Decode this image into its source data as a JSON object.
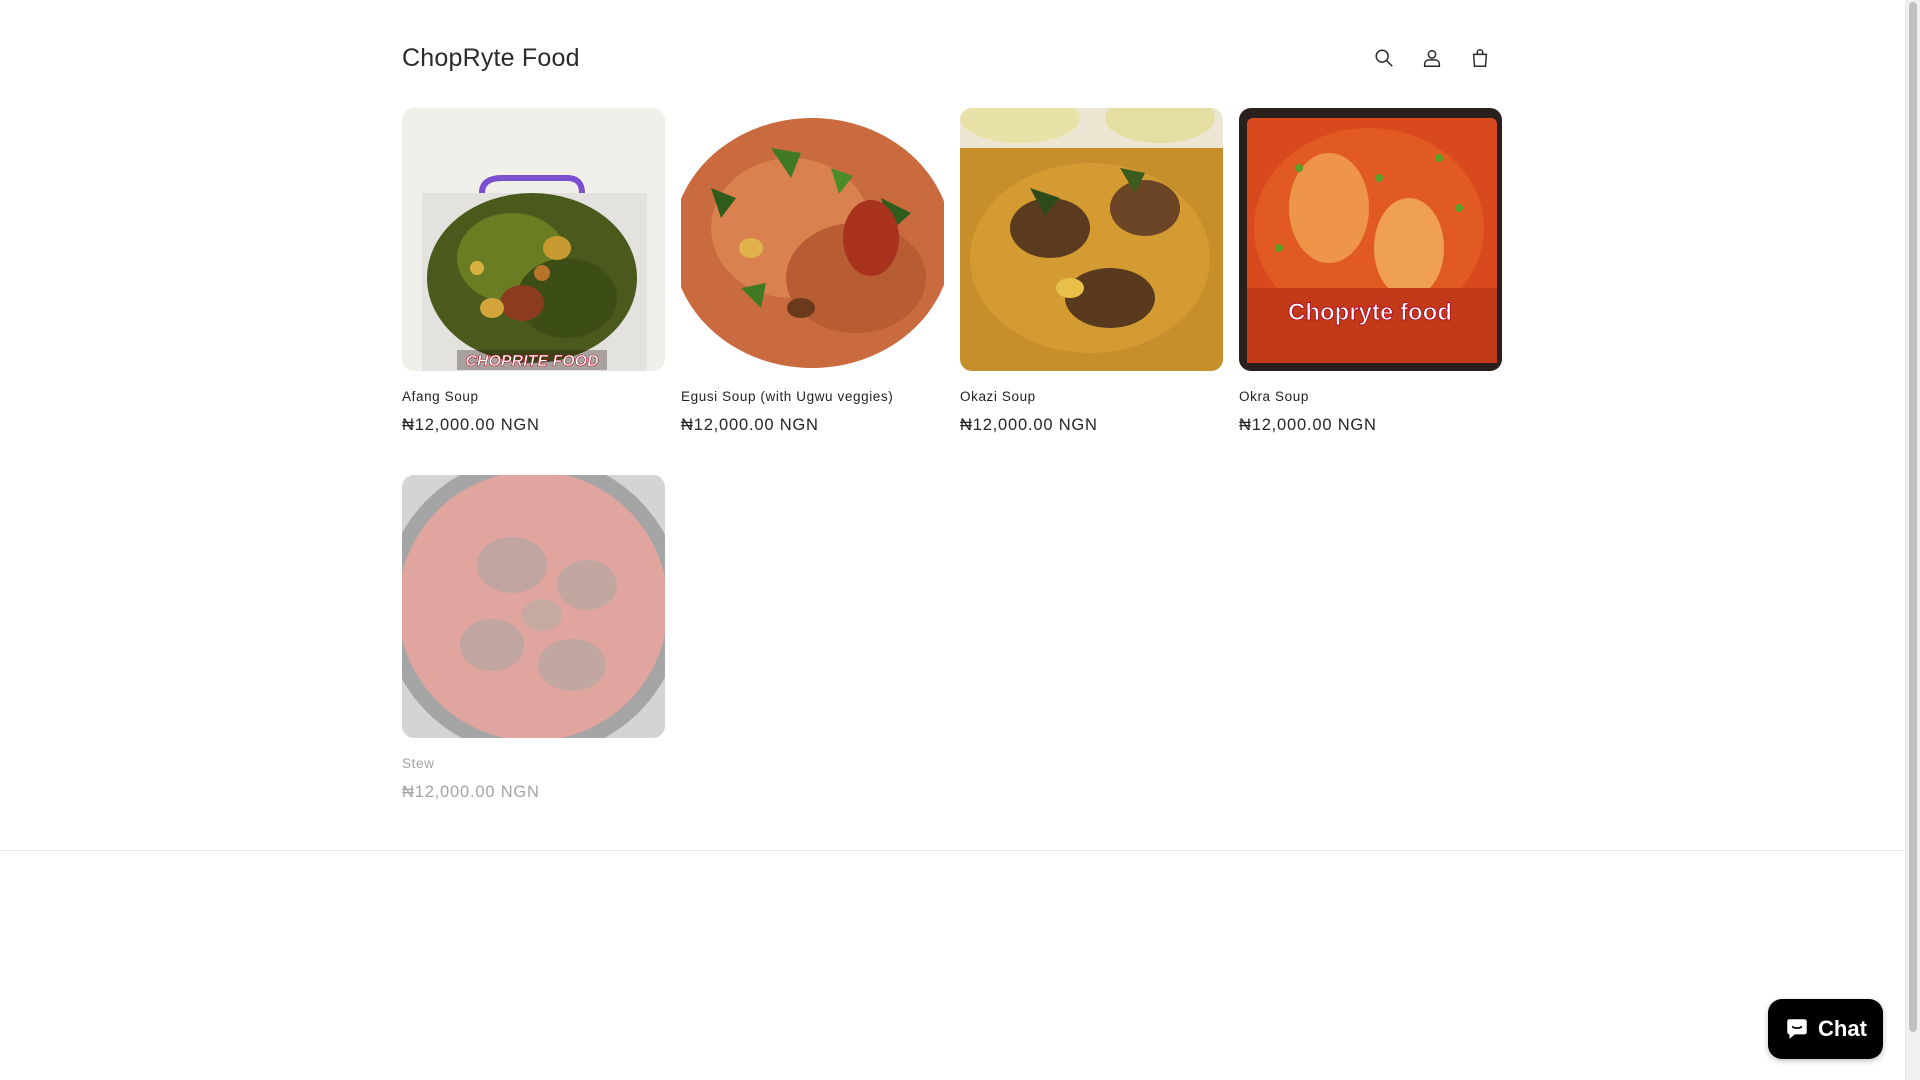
{
  "header": {
    "logo": "ChopRyte Food",
    "icons": [
      "search-icon",
      "account-icon",
      "cart-icon"
    ]
  },
  "products": [
    {
      "title": "Afang Soup",
      "price": "₦12,000.00 NGN",
      "image_caption": "CHOPRITE FOOD"
    },
    {
      "title": "Egusi Soup (with Ugwu veggies)",
      "price": "₦12,000.00 NGN"
    },
    {
      "title": "Okazi Soup",
      "price": "₦12,000.00 NGN"
    },
    {
      "title": "Okra Soup",
      "price": "₦12,000.00 NGN",
      "image_caption": "Chopryte food"
    },
    {
      "title": "Stew",
      "price": "₦12,000.00 NGN"
    }
  ],
  "chat": {
    "label": "Chat",
    "accent": "#000000"
  }
}
